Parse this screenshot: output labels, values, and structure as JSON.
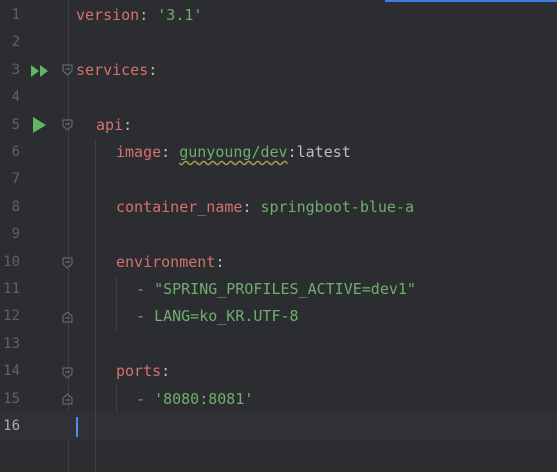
{
  "editor": {
    "language": "yaml",
    "lines": [
      {
        "number": "1",
        "parts": [
          {
            "t": "key",
            "v": "version"
          },
          {
            "t": "plain",
            "v": ": "
          },
          {
            "t": "str",
            "v": "'3.1'"
          }
        ]
      },
      {
        "number": "2",
        "parts": []
      },
      {
        "number": "3",
        "parts": [
          {
            "t": "key",
            "v": "services"
          },
          {
            "t": "plain",
            "v": ":"
          }
        ]
      },
      {
        "number": "4",
        "parts": []
      },
      {
        "number": "5",
        "parts": [
          {
            "t": "key",
            "v": "api"
          },
          {
            "t": "plain",
            "v": ":"
          }
        ]
      },
      {
        "number": "6",
        "parts": [
          {
            "t": "key",
            "v": "image"
          },
          {
            "t": "plain",
            "v": ": "
          },
          {
            "t": "str squiggle",
            "v": "gunyoung/dev"
          },
          {
            "t": "plain",
            "v": ":latest"
          }
        ]
      },
      {
        "number": "7",
        "parts": []
      },
      {
        "number": "8",
        "parts": [
          {
            "t": "key",
            "v": "container_name"
          },
          {
            "t": "plain",
            "v": ": "
          },
          {
            "t": "str",
            "v": "springboot-blue-a"
          }
        ]
      },
      {
        "number": "9",
        "parts": []
      },
      {
        "number": "10",
        "parts": [
          {
            "t": "key",
            "v": "environment"
          },
          {
            "t": "plain",
            "v": ":"
          }
        ]
      },
      {
        "number": "11",
        "parts": [
          {
            "t": "dash",
            "v": "- "
          },
          {
            "t": "str",
            "v": "\"SPRING_PROFILES_ACTIVE=dev1\""
          }
        ]
      },
      {
        "number": "12",
        "parts": [
          {
            "t": "dash",
            "v": "- "
          },
          {
            "t": "str",
            "v": "LANG=ko_KR.UTF-8"
          }
        ]
      },
      {
        "number": "13",
        "parts": []
      },
      {
        "number": "14",
        "parts": [
          {
            "t": "key",
            "v": "ports"
          },
          {
            "t": "plain",
            "v": ":"
          }
        ]
      },
      {
        "number": "15",
        "parts": [
          {
            "t": "dash",
            "v": "- "
          },
          {
            "t": "str",
            "v": "'8080:8081'"
          }
        ]
      },
      {
        "number": "16",
        "parts": []
      }
    ]
  },
  "gutter_icons": {
    "line_3": "run-all-services-icon",
    "line_5": "run-service-icon"
  },
  "colors": {
    "background": "#2b2d30",
    "key": "#d7706f",
    "string": "#6fae6d",
    "plain": "#bcbec4",
    "line_number": "#5f6368",
    "run_icon": "#5fb85f",
    "caret": "#4b8ef0"
  }
}
